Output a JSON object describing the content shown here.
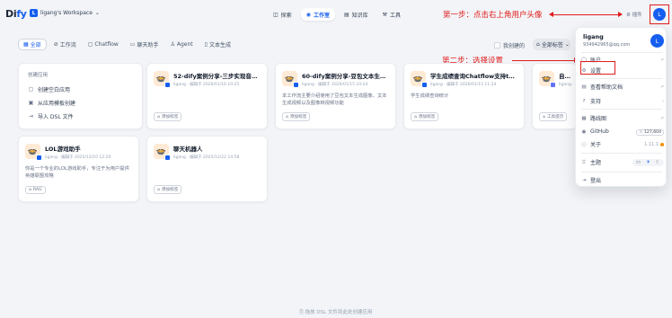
{
  "header": {
    "logo_main": "Di",
    "logo_accent": "fy",
    "workspace_badge": "L",
    "workspace_name": "ligang's Workspace",
    "nav": [
      {
        "label": "探索",
        "icon": "explore-icon"
      },
      {
        "label": "工作室",
        "icon": "studio-icon",
        "active": true
      },
      {
        "label": "知识库",
        "icon": "knowledge-icon"
      },
      {
        "label": "工具",
        "icon": "tools-icon"
      }
    ],
    "right_label": "插件",
    "avatar_letter": "L"
  },
  "annotations": {
    "step1": "第一步：点击右上角用户头像",
    "step2": "第二步：选择设置"
  },
  "filters": {
    "tabs": [
      {
        "label": "全部",
        "active": true
      },
      {
        "label": "工作流"
      },
      {
        "label": "Chatflow"
      },
      {
        "label": "聊天助手"
      },
      {
        "label": "Agent"
      },
      {
        "label": "文本生成"
      }
    ],
    "mine_label": "我创建的",
    "tag_select": "全部标签"
  },
  "create_card": {
    "title": "创建应用",
    "items": [
      "创建空白应用",
      "从应用模板创建",
      "导入 DSL 文件"
    ]
  },
  "apps": [
    {
      "name": "52-dify案例分享-三步实现音…",
      "meta": "ligang · 编辑于 2026/01/16 10:25",
      "desc": "",
      "tag": "添加标签"
    },
    {
      "name": "60-dify案例分享-豆包文本生…",
      "meta": "ligang · 编辑于 2026/01/15 10:24",
      "desc": "本工作流主要介绍使用了豆包文本生成图像、文本生成视频以及图像转视频功能",
      "tag": "添加标签"
    },
    {
      "name": "学生成绩查询Chatflow支持te…",
      "meta": "ligang · 编辑于 2026/01/15 11:24",
      "desc": "学生成绩查询统计",
      "tag": "添加标签"
    },
    {
      "name": "自动查询…",
      "meta": "ligang · 编辑于…",
      "desc": "",
      "tag": "工具提示"
    },
    {
      "name": "LOL游戏助手",
      "meta": "ligang · 编辑于 2025/12/10 12:20",
      "desc": "你是一个专业的LOL游戏助手，专注于为用户提供英雄联盟攻略",
      "tag": "RAG"
    },
    {
      "name": "聊天机器人",
      "meta": "ligang · 编辑于 2025/12/22 14:58",
      "desc": "",
      "tag": "添加标签"
    }
  ],
  "footer": "拖放 DSL 文件到此处创建应用",
  "dropdown": {
    "name": "ligang",
    "email": "934942965@qq.com",
    "avatar_letter": "L",
    "items": {
      "account": "账户",
      "settings": "设置",
      "docs": "查看帮助文档",
      "support": "支持",
      "roadmap": "路线图",
      "github": "GitHub",
      "github_stars": "☆ 127,604",
      "about": "关于",
      "version": "1.11.1",
      "theme": "主题",
      "logout": "登出"
    }
  }
}
